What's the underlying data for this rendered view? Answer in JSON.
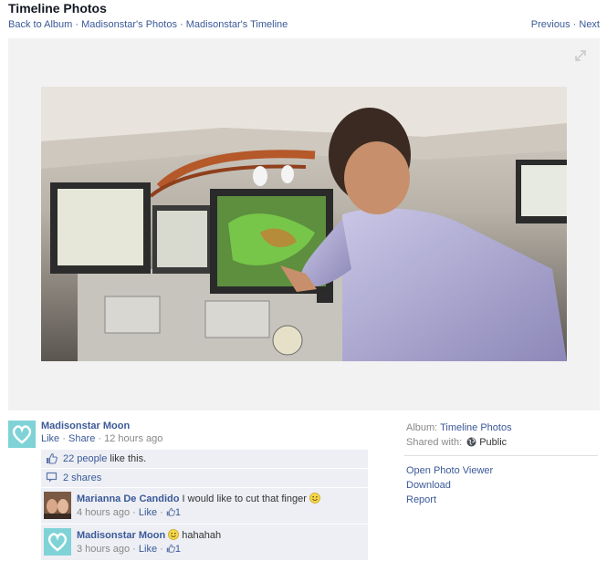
{
  "header": {
    "title": "Timeline Photos"
  },
  "breadcrumb": {
    "back": "Back to Album",
    "sep": "·",
    "photos": "Madisonstar's Photos",
    "timeline": "Madisonstar's Timeline"
  },
  "pager": {
    "previous": "Previous",
    "sep": "·",
    "next": "Next"
  },
  "owner": {
    "name": "Madisonstar Moon",
    "like": "Like",
    "share": "Share",
    "sep": "·",
    "time": "12 hours ago"
  },
  "likes": {
    "count_link": "22 people",
    "suffix": " like this."
  },
  "shares": {
    "label": "2 shares"
  },
  "comments": [
    {
      "name": "Marianna De Candido",
      "text": "I would like to cut that finger",
      "time": "4 hours ago",
      "like": "Like",
      "likes": "1"
    },
    {
      "name": "Madisonstar Moon",
      "text": "hahahah",
      "time": "3 hours ago",
      "like": "Like",
      "likes": "1"
    }
  ],
  "side": {
    "album_label": "Album:",
    "album_value": "Timeline Photos",
    "shared_label": "Shared with:",
    "shared_value": "Public",
    "actions": [
      "Open Photo Viewer",
      "Download",
      "Report"
    ]
  },
  "icons": {
    "expand": "expand-icon",
    "thumb": "thumbs-up-icon",
    "share": "share-icon",
    "globe": "globe-icon",
    "smiley": "smiley-icon"
  },
  "colors": {
    "link": "#3b5998",
    "panel": "#edeff4",
    "stage": "#f2f2f2"
  }
}
